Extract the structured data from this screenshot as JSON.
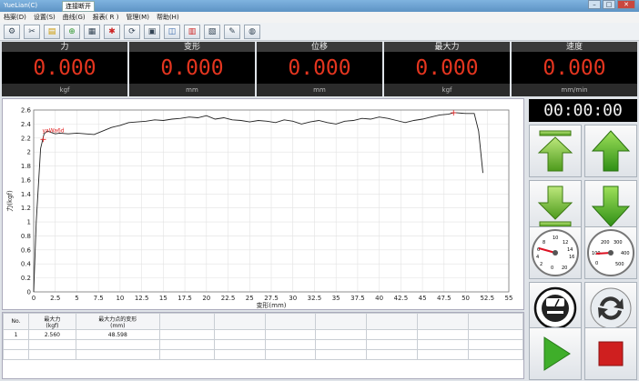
{
  "window": {
    "title": "YueLian(C)",
    "status": "连接断开"
  },
  "menu": [
    "档案(D)",
    "设置(S)",
    "曲线(G)",
    "报表( R )",
    "管理(M)",
    "帮助(H)"
  ],
  "toolbar": [
    "tool-1-icon",
    "tool-2-icon",
    "tool-3-icon",
    "tool-4-icon",
    "tool-5-icon",
    "tool-6-icon",
    "tool-7-icon",
    "tool-8-icon",
    "tool-9-icon",
    "tool-10-icon",
    "tool-11-icon",
    "tool-12-icon",
    "tool-13-icon"
  ],
  "readouts": [
    {
      "label": "力",
      "value": "0.000",
      "unit": "kgf"
    },
    {
      "label": "变形",
      "value": "0.000",
      "unit": "mm"
    },
    {
      "label": "位移",
      "value": "0.000",
      "unit": "mm"
    },
    {
      "label": "最大力",
      "value": "0.000",
      "unit": "kgf"
    },
    {
      "label": "速度",
      "value": "0.000",
      "unit": "mm/min"
    }
  ],
  "timer": "00:00:00",
  "chart_data": {
    "type": "line",
    "xlabel": "变形(mm)",
    "ylabel": "力(kgf)",
    "xlim": [
      0,
      55
    ],
    "ylim": [
      0,
      2.6
    ],
    "xticks": [
      "0",
      "2.5",
      "5",
      "7.5",
      "10",
      "12.5",
      "15",
      "17.5",
      "20",
      "22.5",
      "25",
      "27.5",
      "30",
      "32.5",
      "35",
      "37.5",
      "40",
      "42.5",
      "45",
      "47.5",
      "50",
      "52.5",
      "55"
    ],
    "yticks": [
      "0",
      "0.2",
      "0.4",
      "0.6",
      "0.8",
      "1",
      "1.2",
      "1.4",
      "1.6",
      "1.8",
      "2",
      "2.2",
      "2.4",
      "2.6"
    ],
    "grid": true,
    "annotation": {
      "text": "yaWa6d",
      "x": 1.0,
      "y": 2.28
    },
    "markers": [
      {
        "x": 1.1,
        "y": 2.18
      },
      {
        "x": 48.6,
        "y": 2.56
      }
    ],
    "series": [
      {
        "x": [
          0,
          0.3,
          0.8,
          1.2,
          1.6,
          2,
          2.5,
          3,
          4,
          5,
          6,
          7,
          8,
          9,
          10,
          11,
          12,
          13,
          14,
          15,
          16,
          17,
          18,
          19,
          20,
          21,
          22,
          23,
          24,
          25,
          26,
          27,
          28,
          29,
          30,
          31,
          32,
          33,
          34,
          35,
          36,
          37,
          38,
          39,
          40,
          41,
          42,
          43,
          44,
          45,
          46,
          47,
          48,
          48.6,
          49,
          50,
          51,
          51.5,
          52
        ],
        "y": [
          0,
          1.0,
          2.05,
          2.26,
          2.3,
          2.28,
          2.26,
          2.27,
          2.26,
          2.27,
          2.26,
          2.25,
          2.3,
          2.35,
          2.38,
          2.42,
          2.43,
          2.44,
          2.46,
          2.45,
          2.47,
          2.48,
          2.5,
          2.49,
          2.52,
          2.47,
          2.49,
          2.46,
          2.45,
          2.43,
          2.45,
          2.44,
          2.42,
          2.46,
          2.44,
          2.4,
          2.43,
          2.45,
          2.42,
          2.4,
          2.44,
          2.45,
          2.48,
          2.47,
          2.5,
          2.48,
          2.45,
          2.42,
          2.45,
          2.47,
          2.5,
          2.53,
          2.54,
          2.56,
          2.56,
          2.55,
          2.55,
          2.3,
          1.7
        ]
      }
    ]
  },
  "table": {
    "headers": [
      "No.",
      "最大力\n(kgf)",
      "最大力点的变形\n(mm)",
      "",
      "",
      "",
      "",
      "",
      "",
      ""
    ],
    "rows": [
      [
        "1",
        "2.560",
        "48.598",
        "",
        "",
        "",
        "",
        "",
        "",
        ""
      ]
    ]
  },
  "controls": {
    "gauge_left_ticks": [
      "8",
      "10",
      "12",
      "6",
      "14",
      "4",
      "16",
      "2",
      "0",
      "20"
    ],
    "gauge_right_ticks": [
      "200",
      "300",
      "100",
      "400",
      "0",
      "500"
    ]
  }
}
